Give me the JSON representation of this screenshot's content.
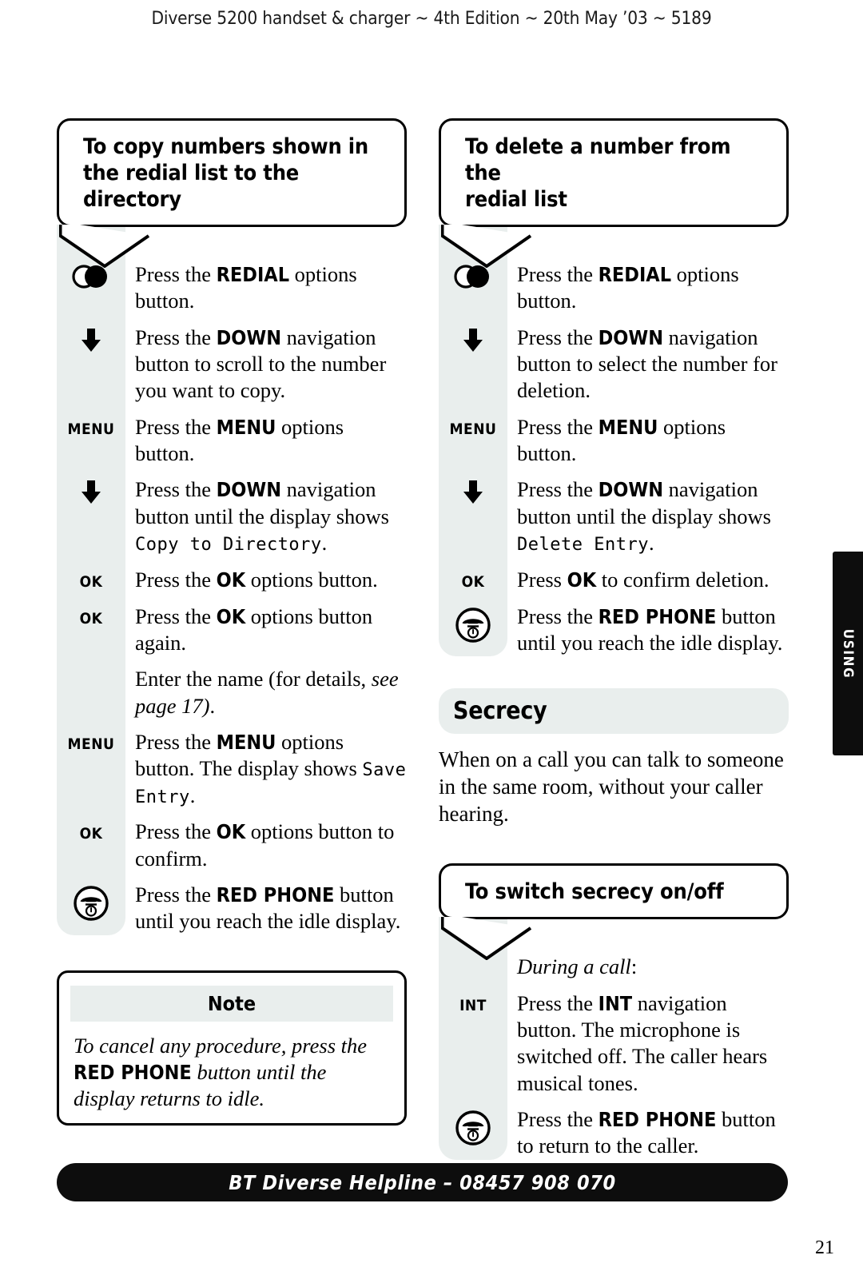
{
  "header": {
    "text": "Diverse 5200 handset & charger ~ 4th Edition ~ 20th May ’03 ~ 5189"
  },
  "side_tab": {
    "label": "USING"
  },
  "footer": {
    "text": "BT Diverse Helpline – 08457 908 070"
  },
  "page_number": "21",
  "colors": {
    "gutter_grey": "#e9eeed",
    "band_grey": "#e9eeed",
    "ink": "#000000",
    "bar_black": "#0d0d0d"
  },
  "left_column": {
    "bubble": {
      "title": "To copy numbers shown in the redial list to the directory",
      "line1": "To copy numbers shown in",
      "line2": "the redial list to the directory"
    },
    "steps": [
      {
        "icon": "redial-icon",
        "icon_label": "",
        "text_html": "Press the <b>REDIAL</b> options button."
      },
      {
        "icon": "down-arrow-icon",
        "icon_label": "",
        "text_html": "Press the <b>DOWN</b> navigation button to scroll to the number you want to copy."
      },
      {
        "icon": "text-icon",
        "icon_label": "MENU",
        "text_html": "Press the <b>MENU</b> options button."
      },
      {
        "icon": "down-arrow-icon",
        "icon_label": "",
        "text_html": "Press the <b>DOWN</b> navigation button until the display shows <span class=\"lcd\">Copy to Directory</span>."
      },
      {
        "icon": "text-icon",
        "icon_label": "OK",
        "text_html": "Press the <b>OK</b> options button."
      },
      {
        "icon": "text-icon",
        "icon_label": "OK",
        "text_html": "Press the <b>OK</b> options button again."
      },
      {
        "icon": "none",
        "icon_label": "",
        "text_html": "Enter the name (for details, <i>see page 17)</i>."
      },
      {
        "icon": "text-icon",
        "icon_label": "MENU",
        "text_html": "Press the <b>MENU</b> options button. The display shows <span class=\"lcd\">Save Entry</span>."
      },
      {
        "icon": "text-icon",
        "icon_label": "OK",
        "text_html": "Press the <b>OK</b> options button to confirm."
      },
      {
        "icon": "red-phone-icon",
        "icon_label": "",
        "text_html": "Press the <b>RED PHONE</b> button until you reach the idle display."
      }
    ],
    "note": {
      "header": "Note",
      "body_html": "To cancel any procedure, press the <b>RED PHONE</b> button until the display returns to idle."
    }
  },
  "right_column": {
    "bubble": {
      "title": "To delete a number from the redial list",
      "line1": "To delete a number from the",
      "line2": "redial list"
    },
    "steps": [
      {
        "icon": "redial-icon",
        "icon_label": "",
        "text_html": "Press the <b>REDIAL</b> options button."
      },
      {
        "icon": "down-arrow-icon",
        "icon_label": "",
        "text_html": "Press the <b>DOWN</b> navigation button to select the number for deletion."
      },
      {
        "icon": "text-icon",
        "icon_label": "MENU",
        "text_html": "Press the <b>MENU</b> options button."
      },
      {
        "icon": "down-arrow-icon",
        "icon_label": "",
        "text_html": "Press the <b>DOWN</b> navigation button until the display shows <span class=\"lcd\">Delete Entry</span>."
      },
      {
        "icon": "text-icon",
        "icon_label": "OK",
        "text_html": "Press <b>OK</b> to confirm deletion."
      },
      {
        "icon": "red-phone-icon",
        "icon_label": "",
        "text_html": "Press the <b>RED PHONE</b> button until you reach the idle display."
      }
    ],
    "section": {
      "title": "Secrecy",
      "paragraph": "When on a call you can talk to someone in the same room, without your caller hearing."
    },
    "bubble2": {
      "title": "To switch secrecy on/off"
    },
    "steps2": [
      {
        "icon": "none",
        "icon_label": "",
        "text_html": "<i>During a call</i>:"
      },
      {
        "icon": "text-icon",
        "icon_label": "INT",
        "text_html": "Press the <b>INT</b> navigation button. The microphone is switched off. The caller hears musical tones."
      },
      {
        "icon": "red-phone-icon",
        "icon_label": "",
        "text_html": "Press the <b>RED PHONE</b> button to return to the caller."
      }
    ]
  }
}
